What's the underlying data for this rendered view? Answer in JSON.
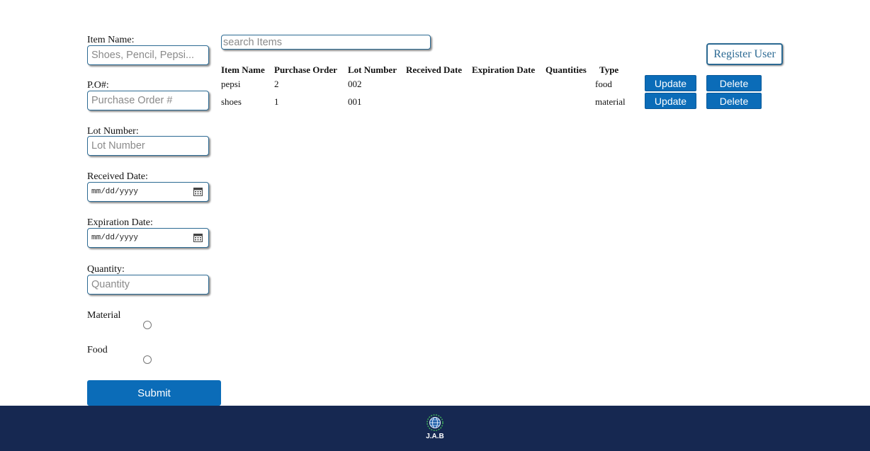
{
  "form": {
    "item_name_label": "Item Name:",
    "item_name_placeholder": "Shoes, Pencil, Pepsi...",
    "po_label": "P.O#:",
    "po_placeholder": "Purchase Order #",
    "lot_label": "Lot Number:",
    "lot_placeholder": "Lot Number",
    "received_label": "Received Date:",
    "received_value": "mm/dd/yyyy",
    "expiration_label": "Expiration Date:",
    "expiration_value": "mm/dd/yyyy",
    "quantity_label": "Quantity:",
    "quantity_placeholder": "Quantity",
    "material_label": "Material",
    "food_label": "Food",
    "submit_label": "Submit"
  },
  "search": {
    "placeholder": "search Items"
  },
  "register_label": "Register User",
  "table": {
    "headers": [
      "Item Name",
      "Purchase Order",
      "Lot Number",
      "Received Date",
      "Expiration Date",
      "Quantities",
      "Type"
    ],
    "rows": [
      {
        "item": "pepsi",
        "po": "2",
        "lot": "002",
        "received": "",
        "expiration": "",
        "quantity": "",
        "type": "food",
        "update": "Update",
        "delete": "Delete"
      },
      {
        "item": "shoes",
        "po": "1",
        "lot": "001",
        "received": "",
        "expiration": "",
        "quantity": "",
        "type": "material",
        "update": "Update",
        "delete": "Delete"
      }
    ]
  },
  "footer": {
    "logo_text": "J.A.B",
    "background": "#162851"
  },
  "colors": {
    "accent": "#0b6cb8",
    "border": "#2c6a93"
  }
}
